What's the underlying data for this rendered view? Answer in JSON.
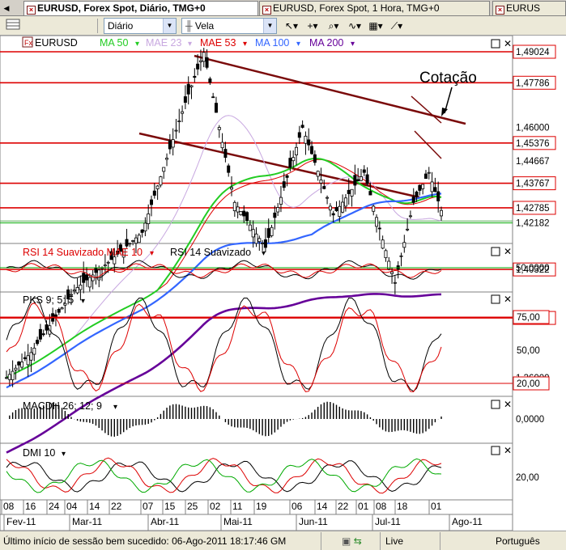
{
  "tabs": [
    {
      "label": "EURUSD, Forex Spot, Diário, TMG+0",
      "icon": "chart-tab-icon",
      "active": true
    },
    {
      "label": "EURUSD, Forex Spot, 1 Hora, TMG+0",
      "icon": "chart-tab-icon",
      "active": false
    },
    {
      "label": "EURUS",
      "icon": "chart-tab-icon",
      "active": false
    }
  ],
  "toolbar": {
    "period_value": "Diário",
    "chart_type_value": "Vela",
    "icons": [
      "arrow-dropdown-icon",
      "crosshair-icon",
      "zoom-icon",
      "wave-icon",
      "grid-icon",
      "line-tool-icon"
    ]
  },
  "main_panel": {
    "symbol": "EURUSD",
    "indicators": [
      {
        "label": "MA 50",
        "color": "#22cc22"
      },
      {
        "label": "MAE 23",
        "color": "#c8a8e0"
      },
      {
        "label": "MAE 53",
        "color": "#dd0000"
      },
      {
        "label": "MA 100",
        "color": "#3366ff"
      },
      {
        "label": "MA 200",
        "color": "#660099"
      }
    ],
    "annotation": "Cotação",
    "price_labels": [
      "1,49024",
      "1,47786",
      "1,46000",
      "1,45376",
      "1,44667",
      "1,43767",
      "1,42785",
      "1,42182",
      "1,40322",
      "1,38384",
      "1,36000"
    ]
  },
  "panels": [
    {
      "label": "RSI 14 Suavizado MAE 10",
      "label2": "RSI 14 Suavizado",
      "values": [
        "50,0000"
      ]
    },
    {
      "label": "PKS 9; 5; 5",
      "values": [
        "75,00",
        "50,00",
        "20,00"
      ]
    },
    {
      "label": "MACDH 26; 12; 9",
      "values": [
        "0,0000"
      ]
    },
    {
      "label": "DMI 10",
      "values": [
        "20,00"
      ]
    }
  ],
  "x_axis": {
    "days": [
      "08",
      "16",
      "24",
      "04",
      "14",
      "22",
      "07",
      "15",
      "25",
      "02",
      "11",
      "19",
      "06",
      "14",
      "22",
      "01",
      "08",
      "18",
      "01"
    ],
    "months": [
      "Fev-11",
      "Mar-11",
      "Abr-11",
      "Mai-11",
      "Jun-11",
      "Jul-11",
      "Ago-11"
    ]
  },
  "status_bar": {
    "message": "Último início de sessão bem sucedido: 06-Ago-2011 18:17:46 GM",
    "connection": "Live",
    "language": "Português"
  },
  "colors": {
    "up_candle": "#00aa00",
    "down_candle": "#cc0000",
    "level_lines": "#dd0000",
    "channel": "#7a0a0a"
  }
}
